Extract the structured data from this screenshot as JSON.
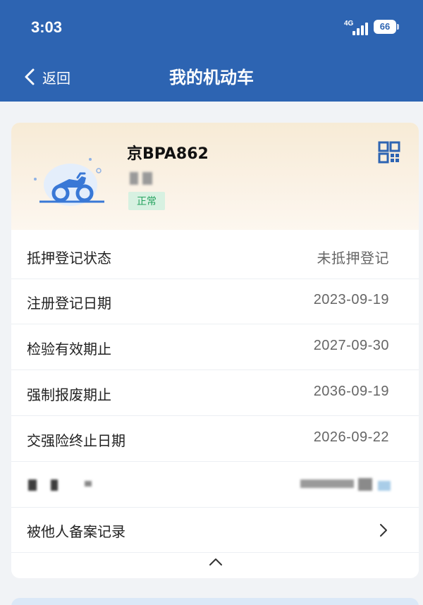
{
  "status_bar": {
    "time": "3:03",
    "network": "4G",
    "battery": "66"
  },
  "nav": {
    "back_label": "返回",
    "title": "我的机动车"
  },
  "vehicle": {
    "plate": "京BPA862",
    "status": "正常",
    "icon": "motorcycle-icon",
    "qr_icon": "qr-code-icon"
  },
  "details": [
    {
      "label": "抵押登记状态",
      "value": "未抵押登记"
    },
    {
      "label": "注册登记日期",
      "value": "2023-09-19"
    },
    {
      "label": "检验有效期止",
      "value": "2027-09-30"
    },
    {
      "label": "强制报废期止",
      "value": "2036-09-19"
    },
    {
      "label": "交强险终止日期",
      "value": "2026-09-22"
    }
  ],
  "filing_record": {
    "label": "被他人备案记录"
  },
  "colors": {
    "header": "#2d64b2",
    "badge_bg": "#d7f1e1",
    "badge_text": "#27a360",
    "accent": "#2d64b2"
  }
}
